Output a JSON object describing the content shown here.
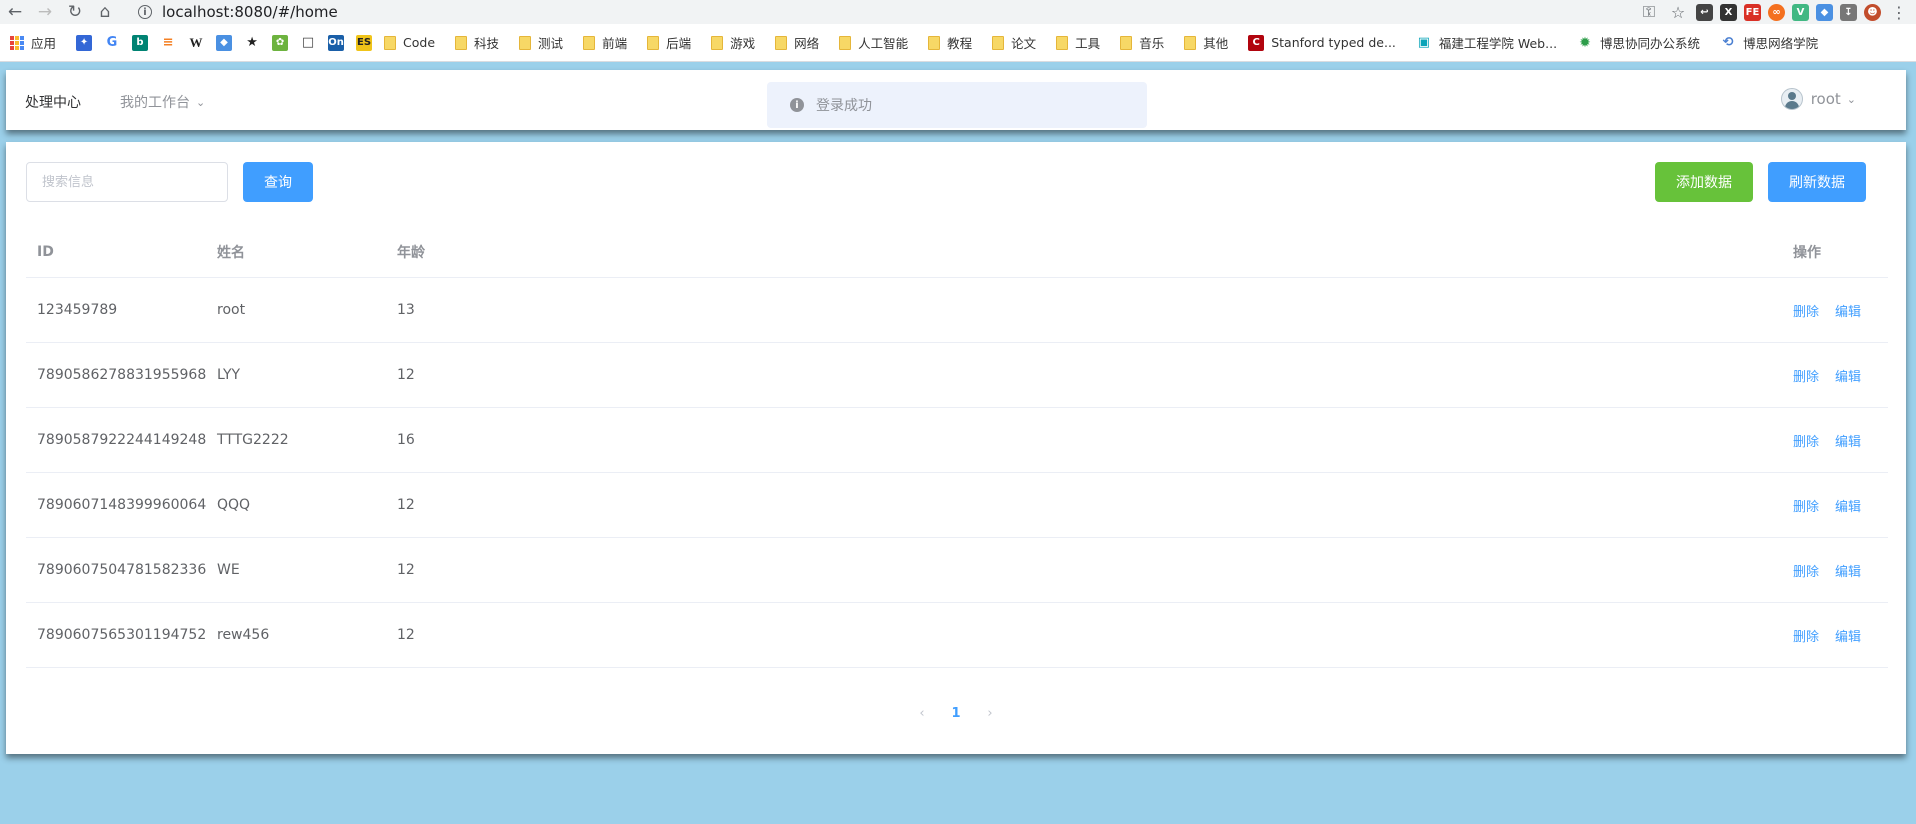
{
  "browser": {
    "url": "localhost:8080/#/home",
    "bookmarks": [
      {
        "label": "应用",
        "icon": "apps-grid-icon"
      },
      {
        "label": "",
        "icon": "puzzle-icon"
      },
      {
        "label": "",
        "icon": "google-icon"
      },
      {
        "label": "",
        "icon": "bing-icon"
      },
      {
        "label": "",
        "icon": "stackoverflow-icon"
      },
      {
        "label": "",
        "icon": "wikipedia-icon"
      },
      {
        "label": "",
        "icon": "diamond-icon"
      },
      {
        "label": "",
        "icon": "runner-icon"
      },
      {
        "label": "",
        "icon": "spring-icon"
      },
      {
        "label": "",
        "icon": "folder-outline-icon"
      },
      {
        "label": "",
        "icon": "on-icon"
      },
      {
        "label": "",
        "icon": "es-icon"
      },
      {
        "label": "Code",
        "icon": "folder-icon"
      },
      {
        "label": "科技",
        "icon": "folder-icon"
      },
      {
        "label": "测试",
        "icon": "folder-icon"
      },
      {
        "label": "前端",
        "icon": "folder-icon"
      },
      {
        "label": "后端",
        "icon": "folder-icon"
      },
      {
        "label": "游戏",
        "icon": "folder-icon"
      },
      {
        "label": "网络",
        "icon": "folder-icon"
      },
      {
        "label": "人工智能",
        "icon": "folder-icon"
      },
      {
        "label": "教程",
        "icon": "folder-icon"
      },
      {
        "label": "论文",
        "icon": "folder-icon"
      },
      {
        "label": "工具",
        "icon": "folder-icon"
      },
      {
        "label": "音乐",
        "icon": "folder-icon"
      },
      {
        "label": "其他",
        "icon": "folder-icon"
      },
      {
        "label": "Stanford typed de...",
        "icon": "stanford-icon"
      },
      {
        "label": "福建工程学院 Web...",
        "icon": "lock-icon"
      },
      {
        "label": "博思协同办公系统",
        "icon": "gear-icon"
      },
      {
        "label": "博思网络学院",
        "icon": "swirl-icon"
      }
    ]
  },
  "header": {
    "brand": "处理中心",
    "menu_workbench": "我的工作台",
    "user_name": "root"
  },
  "message": {
    "text": "登录成功"
  },
  "toolbar": {
    "search_placeholder": "搜索信息",
    "query_label": "查询",
    "add_label": "添加数据",
    "refresh_label": "刷新数据"
  },
  "table": {
    "headers": {
      "id": "ID",
      "name": "姓名",
      "age": "年龄",
      "op": "操作"
    },
    "delete_label": "删除",
    "edit_label": "编辑",
    "rows": [
      {
        "id": "123459789",
        "name": "root",
        "age": "13"
      },
      {
        "id": "7890586278831955968",
        "name": "LYY",
        "age": "12"
      },
      {
        "id": "7890587922244149248",
        "name": "TTTG2222",
        "age": "16"
      },
      {
        "id": "7890607148399960064",
        "name": "QQQ",
        "age": "12"
      },
      {
        "id": "7890607504781582336",
        "name": "WE",
        "age": "12"
      },
      {
        "id": "7890607565301194752",
        "name": "rew456",
        "age": "12"
      }
    ]
  },
  "pagination": {
    "current_page": "1"
  }
}
